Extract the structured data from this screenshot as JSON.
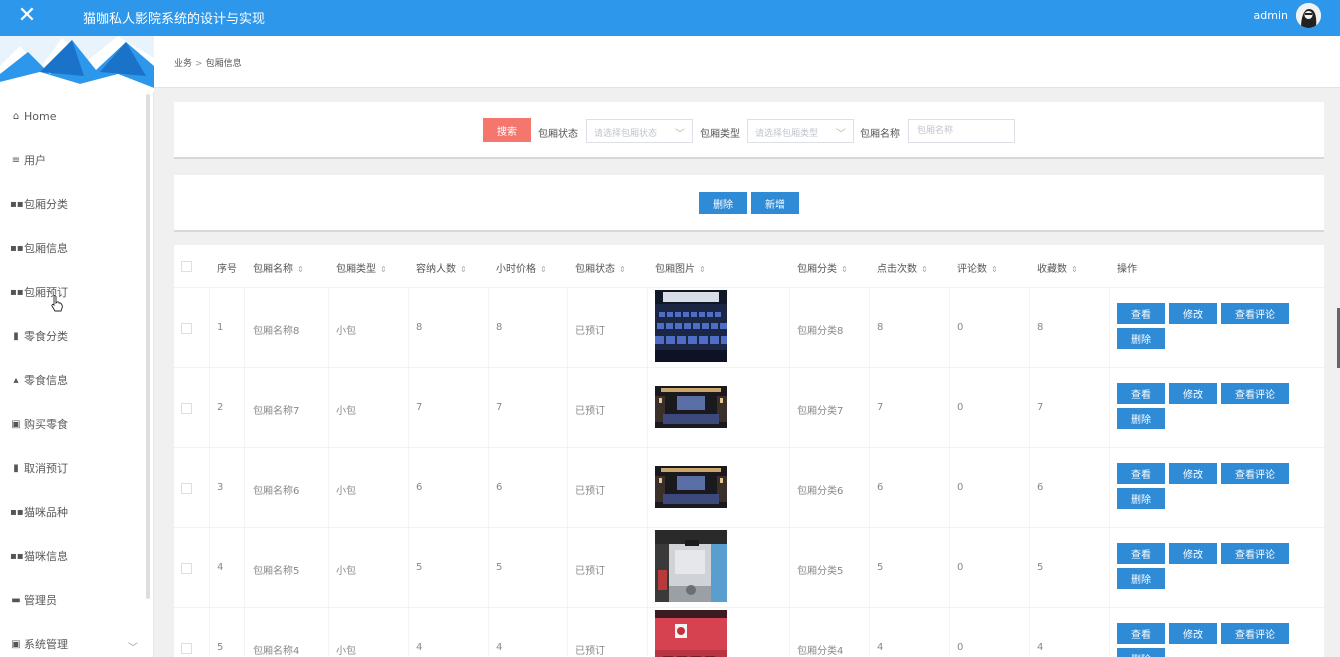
{
  "header": {
    "title": "猫咖私人影院系统的设计与实现",
    "user": "admin",
    "accent_color": "#2d97eb"
  },
  "sidebar": {
    "items": [
      {
        "icon": "home-icon",
        "label": "Home"
      },
      {
        "icon": "list-icon",
        "label": "用户"
      },
      {
        "icon": "grid-icon",
        "label": "包厢分类"
      },
      {
        "icon": "grid-icon",
        "label": "包厢信息"
      },
      {
        "icon": "grid-icon",
        "label": "包厢预订"
      },
      {
        "icon": "bar-chart-icon",
        "label": "零食分类"
      },
      {
        "icon": "thumbs-up-icon",
        "label": "零食信息"
      },
      {
        "icon": "clipboard-icon",
        "label": "购买零食"
      },
      {
        "icon": "bar-chart-icon",
        "label": "取消预订"
      },
      {
        "icon": "grid-icon",
        "label": "猫咪品种"
      },
      {
        "icon": "grid-icon",
        "label": "猫咪信息"
      },
      {
        "icon": "monitor-icon",
        "label": "管理员"
      },
      {
        "icon": "clipboard-icon",
        "label": "系统管理"
      }
    ]
  },
  "breadcrumb": {
    "parent": "业务",
    "separator": ">",
    "current": "包厢信息"
  },
  "search": {
    "button": "搜索",
    "status_label": "包厢状态",
    "status_placeholder": "请选择包厢状态",
    "type_label": "包厢类型",
    "type_placeholder": "请选择包厢类型",
    "name_label": "包厢名称",
    "name_placeholder": "包厢名称"
  },
  "actions": {
    "delete": "删除",
    "add": "新增"
  },
  "table": {
    "headers": {
      "index": "序号",
      "name": "包厢名称",
      "type": "包厢类型",
      "capacity": "容纳人数",
      "price": "小时价格",
      "status": "包厢状态",
      "image": "包厢图片",
      "category": "包厢分类",
      "clicks": "点击次数",
      "comments": "评论数",
      "favorites": "收藏数",
      "ops": "操作"
    },
    "op_labels": {
      "view": "查看",
      "edit": "修改",
      "view_comments": "查看评论",
      "delete": "删除"
    },
    "rows": [
      {
        "index": "1",
        "name": "包厢名称8",
        "type": "小包",
        "capacity": "8",
        "price": "8",
        "status": "已预订",
        "image": "cinema-seats-image",
        "category": "包厢分类8",
        "clicks": "8",
        "comments": "0",
        "favorites": "8"
      },
      {
        "index": "2",
        "name": "包厢名称7",
        "type": "小包",
        "capacity": "7",
        "price": "7",
        "status": "已预订",
        "image": "theater-room-image",
        "category": "包厢分类7",
        "clicks": "7",
        "comments": "0",
        "favorites": "7"
      },
      {
        "index": "3",
        "name": "包厢名称6",
        "type": "小包",
        "capacity": "6",
        "price": "6",
        "status": "已预订",
        "image": "theater-room-image",
        "category": "包厢分类6",
        "clicks": "6",
        "comments": "0",
        "favorites": "6"
      },
      {
        "index": "4",
        "name": "包厢名称5",
        "type": "小包",
        "capacity": "5",
        "price": "5",
        "status": "已预订",
        "image": "lobby-image",
        "category": "包厢分类5",
        "clicks": "5",
        "comments": "0",
        "favorites": "5"
      },
      {
        "index": "5",
        "name": "包厢名称4",
        "type": "小包",
        "capacity": "4",
        "price": "4",
        "status": "已预订",
        "image": "red-hall-image",
        "category": "包厢分类4",
        "clicks": "4",
        "comments": "0",
        "favorites": "4"
      }
    ]
  }
}
